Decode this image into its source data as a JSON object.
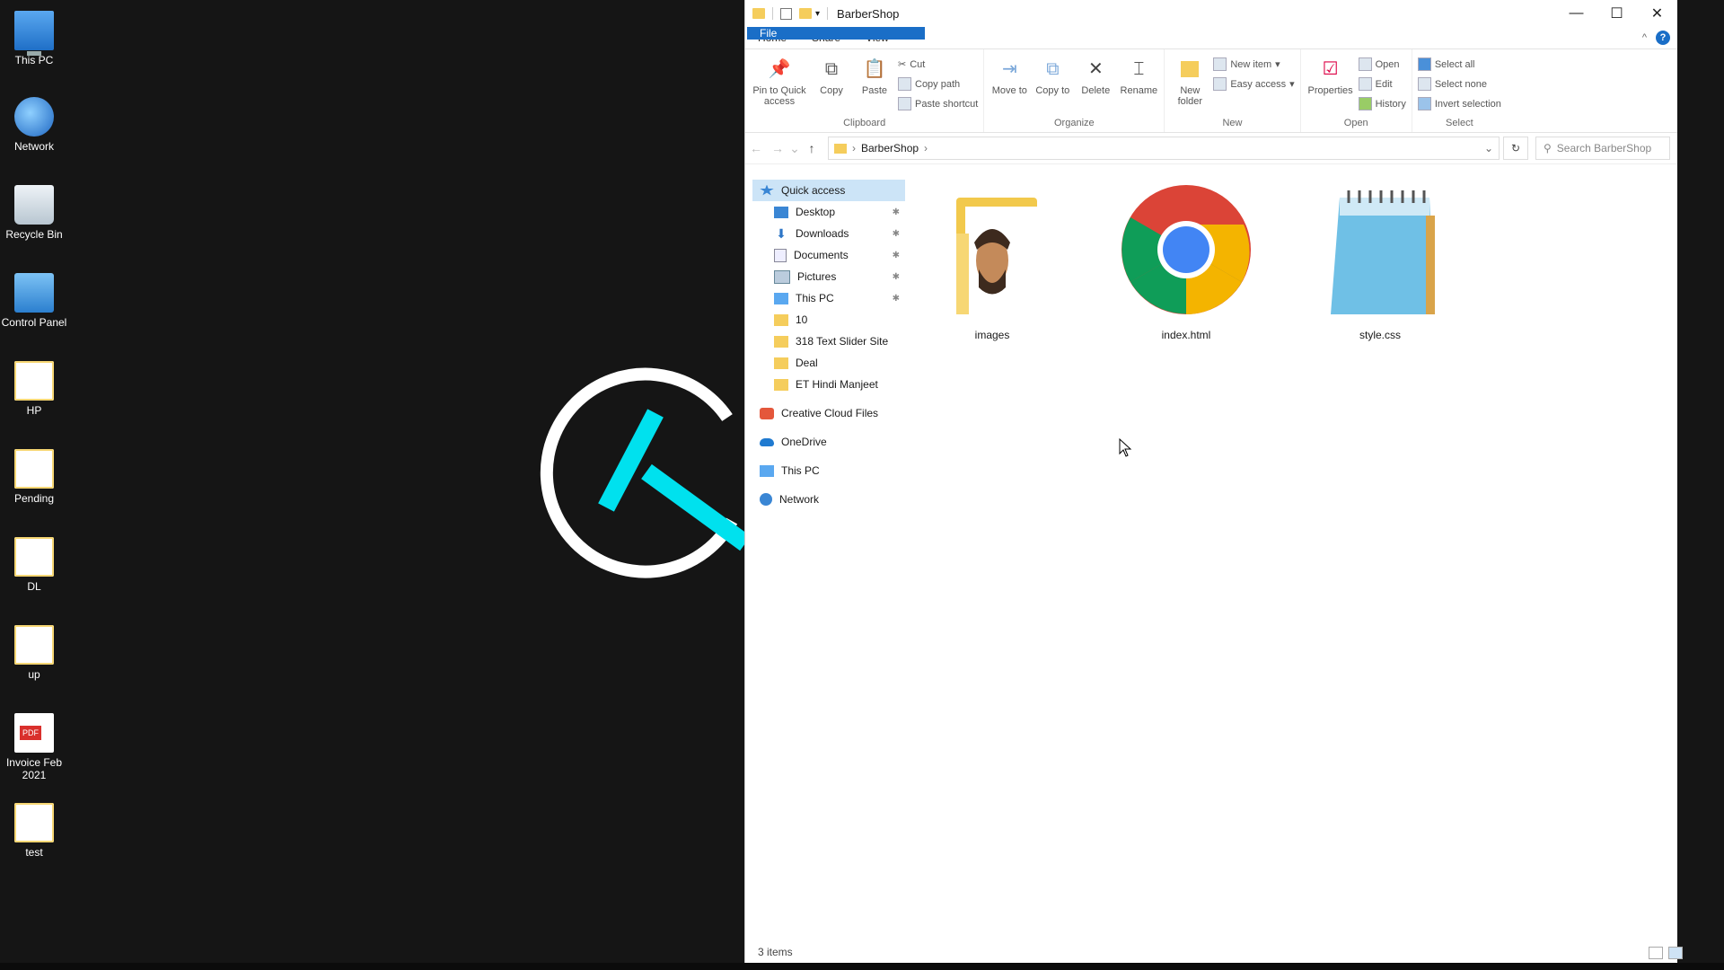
{
  "desktop": {
    "icons": [
      {
        "label": "This PC",
        "icon": "this-pc-icon"
      },
      {
        "label": "Network",
        "icon": "network-icon"
      },
      {
        "label": "Recycle Bin",
        "icon": "recycle-bin-icon"
      },
      {
        "label": "Control Panel",
        "icon": "control-panel-icon"
      },
      {
        "label": "HP",
        "icon": "folder-icon"
      },
      {
        "label": "Pending",
        "icon": "folder-icon"
      },
      {
        "label": "DL",
        "icon": "folder-icon"
      },
      {
        "label": "up",
        "icon": "folder-icon"
      },
      {
        "label": "Invoice Feb 2021",
        "icon": "pdf-icon"
      },
      {
        "label": "test",
        "icon": "folder-icon"
      }
    ]
  },
  "window": {
    "title": "BarberShop",
    "controls": {
      "minimize": "—",
      "maximize": "☐",
      "close": "✕"
    }
  },
  "ribbon": {
    "tabs": [
      "File",
      "Home",
      "Share",
      "View"
    ],
    "help": "?",
    "groups": {
      "clipboard": {
        "label": "Clipboard",
        "pin": "Pin to Quick access",
        "copy": "Copy",
        "paste": "Paste",
        "cut": "Cut",
        "copy_path": "Copy path",
        "paste_shortcut": "Paste shortcut"
      },
      "organize": {
        "label": "Organize",
        "move_to": "Move to",
        "copy_to": "Copy to",
        "delete": "Delete",
        "rename": "Rename"
      },
      "new": {
        "label": "New",
        "new_folder": "New folder",
        "new_item": "New item",
        "easy_access": "Easy access"
      },
      "open": {
        "label": "Open",
        "properties": "Properties",
        "open": "Open",
        "edit": "Edit",
        "history": "History"
      },
      "select": {
        "label": "Select",
        "select_all": "Select all",
        "select_none": "Select none",
        "invert_selection": "Invert selection"
      }
    }
  },
  "address": {
    "crumb": "BarberShop",
    "search_placeholder": "Search BarberShop"
  },
  "nav": {
    "quick_access": "Quick access",
    "pinned": [
      "Desktop",
      "Downloads",
      "Documents",
      "Pictures",
      "This PC"
    ],
    "recent": [
      "10",
      "318 Text Slider Site",
      "Deal",
      "ET Hindi Manjeet"
    ],
    "creative_cloud": "Creative Cloud Files",
    "onedrive": "OneDrive",
    "this_pc": "This PC",
    "network": "Network"
  },
  "files": [
    {
      "name": "images",
      "icon": "folder-icon"
    },
    {
      "name": "index.html",
      "icon": "chrome-icon"
    },
    {
      "name": "style.css",
      "icon": "notepad-icon"
    }
  ],
  "status": {
    "items": "3 items"
  },
  "colors": {
    "accent": "#1a6ec7",
    "logo_cyan": "#00e1ee",
    "selection": "#cce4f7"
  }
}
